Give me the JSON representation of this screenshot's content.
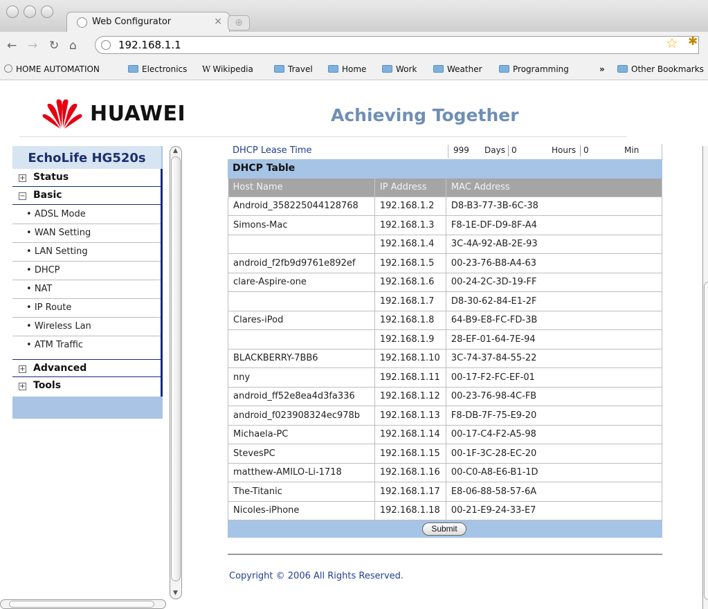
{
  "browser": {
    "tab_title": "Web Configurator",
    "tab_close": "×",
    "url": "192.168.1.1",
    "bookmarks": [
      {
        "label": "HOME AUTOMATION",
        "icon": "globe-icon"
      },
      {
        "label": "Electronics",
        "icon": "folder-icon"
      },
      {
        "label": "Wikipedia",
        "icon": "wikipedia-icon"
      },
      {
        "label": "Travel",
        "icon": "folder-icon"
      },
      {
        "label": "Home",
        "icon": "folder-icon"
      },
      {
        "label": "Work",
        "icon": "folder-icon"
      },
      {
        "label": "Weather",
        "icon": "folder-icon"
      },
      {
        "label": "Programming",
        "icon": "folder-icon"
      },
      {
        "label": "Other Bookmarks",
        "icon": "folder-icon"
      }
    ],
    "overflow_glyph": "»"
  },
  "header": {
    "brand": "HUAWEI",
    "slogan": "Achieving Together",
    "brand_color": "#e60012",
    "slogan_color": "#6f8fb4"
  },
  "sidebar": {
    "device": "EchoLife HG520s",
    "menus": [
      {
        "label": "Status",
        "toggle": "+"
      },
      {
        "label": "Basic",
        "toggle": "−"
      },
      {
        "label": "Advanced",
        "toggle": "+"
      },
      {
        "label": "Tools",
        "toggle": "+"
      }
    ],
    "basic_items": [
      "ADSL Mode",
      "WAN Setting",
      "LAN Setting",
      "DHCP",
      "NAT",
      "IP Route",
      "Wireless Lan",
      "ATM Traffic"
    ]
  },
  "lease": {
    "label": "DHCP Lease Time",
    "days_value": "999",
    "days_label": "Days",
    "hours_value": "0",
    "hours_label": "Hours",
    "min_value": "0",
    "min_label": "Min"
  },
  "dhcp_table": {
    "title": "DHCP Table",
    "columns": [
      "Host Name",
      "IP Address",
      "MAC Address"
    ],
    "rows": [
      [
        "Android_358225044128768",
        "192.168.1.2",
        "D8-B3-77-3B-6C-38"
      ],
      [
        "Simons-Mac",
        "192.168.1.3",
        "F8-1E-DF-D9-8F-A4"
      ],
      [
        "",
        "192.168.1.4",
        "3C-4A-92-AB-2E-93"
      ],
      [
        "android_f2fb9d9761e892ef",
        "192.168.1.5",
        "00-23-76-B8-A4-63"
      ],
      [
        "clare-Aspire-one",
        "192.168.1.6",
        "00-24-2C-3D-19-FF"
      ],
      [
        "",
        "192.168.1.7",
        "D8-30-62-84-E1-2F"
      ],
      [
        "Clares-iPod",
        "192.168.1.8",
        "64-B9-E8-FC-FD-3B"
      ],
      [
        "",
        "192.168.1.9",
        "28-EF-01-64-7E-94"
      ],
      [
        "BLACKBERRY-7BB6",
        "192.168.1.10",
        "3C-74-37-84-55-22"
      ],
      [
        "nny",
        "192.168.1.11",
        "00-17-F2-FC-EF-01"
      ],
      [
        "android_ff52e8ea4d3fa336",
        "192.168.1.12",
        "00-23-76-98-4C-FB"
      ],
      [
        "android_f023908324ec978b",
        "192.168.1.13",
        "F8-DB-7F-75-E9-20"
      ],
      [
        "Michaela-PC",
        "192.168.1.14",
        "00-17-C4-F2-A5-98"
      ],
      [
        "StevesPC",
        "192.168.1.15",
        "00-1F-3C-28-EC-20"
      ],
      [
        "matthew-AMILO-Li-1718",
        "192.168.1.16",
        "00-C0-A8-E6-B1-1D"
      ],
      [
        "The-Titanic",
        "192.168.1.17",
        "E8-06-88-58-57-6A"
      ],
      [
        "Nicoles-iPhone",
        "192.168.1.18",
        "00-21-E9-24-33-E7"
      ]
    ]
  },
  "submit_label": "Submit",
  "footer": {
    "copyright": "Copyright © 2006 All Rights Reserved."
  }
}
